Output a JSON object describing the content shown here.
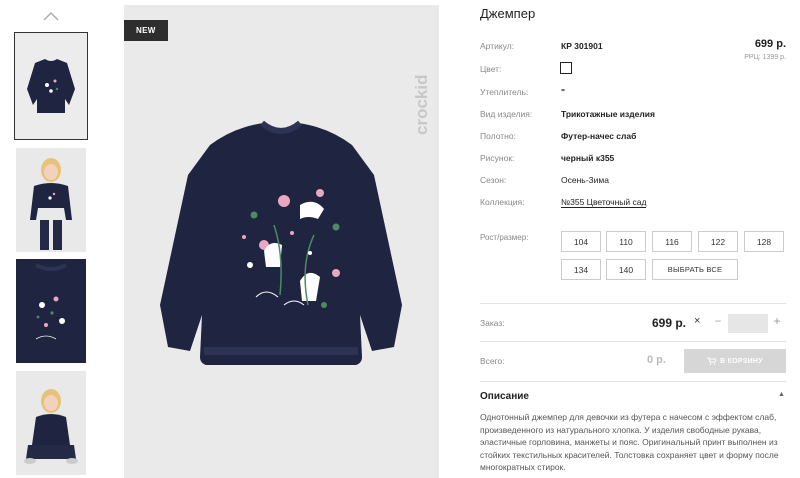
{
  "product": {
    "title": "Джемпер",
    "badge": "NEW",
    "brand": "crockid",
    "price": "699 р.",
    "rrp": "РРЦ: 1399 р."
  },
  "attributes": [
    {
      "label": "Артикул:",
      "value": "КР 301901"
    },
    {
      "label": "Цвет:",
      "value": ""
    },
    {
      "label": "Утеплитель:",
      "value": "\""
    },
    {
      "label": "Вид изделия:",
      "value": "Трикотажные изделия"
    },
    {
      "label": "Полотно:",
      "value": "Футер-начес слаб"
    },
    {
      "label": "Рисунок:",
      "value": "черный к355"
    },
    {
      "label": "Сезон:",
      "value": "Осень-Зима"
    },
    {
      "label": "Коллекция:",
      "value": "№355 Цветочный сад"
    }
  ],
  "color_swatch": "#ffffff",
  "sizes": {
    "label": "Рост/размер:",
    "options": [
      "104",
      "110",
      "116",
      "122",
      "128",
      "134",
      "140"
    ],
    "select_all": "ВЫБРАТЬ ВСЕ"
  },
  "order": {
    "label": "Заказ:",
    "price": "699 р.",
    "times": "×",
    "minus": "−",
    "plus": "+",
    "quantity": ""
  },
  "total": {
    "label": "Всего:",
    "value": "0 р.",
    "cart_button": "В КОРЗИНУ"
  },
  "description": {
    "heading": "Описание",
    "toggle": "▲",
    "text": "Однотонный джемпер для девочки из футера с начесом с эффектом слаб, произведенного из натурального хлопка. У изделия свободные рукава, эластичные горловина, манжеты и пояс. Оригинальный принт выполнен из стойких текстильных красителей. Толстовка сохраняет цвет и форму после многократных стирок."
  },
  "colors": {
    "sweater": "#1f2540",
    "accent_pink": "#e8a9c0",
    "accent_green": "#4e8a63",
    "badge_bg": "#2e2e2e",
    "cart_disabled": "#d6d6d6"
  }
}
